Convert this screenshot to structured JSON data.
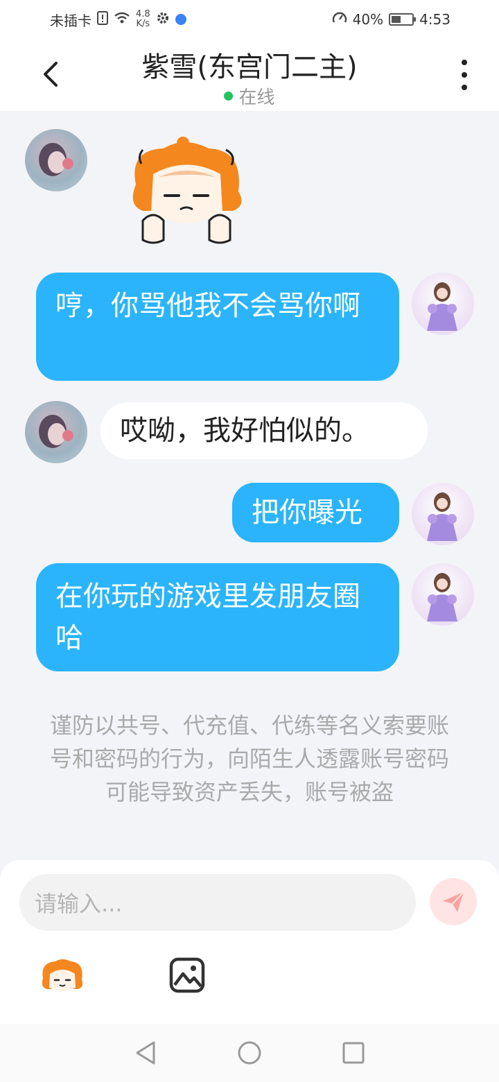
{
  "status_bar": {
    "carrier": "未插卡",
    "net_speed_value": "4.8",
    "net_speed_unit": "K/s",
    "battery": "40%",
    "time": "4:53"
  },
  "header": {
    "title": "紫雪(东宫门二主)",
    "status": "在线"
  },
  "messages": [
    {
      "side": "in",
      "type": "sticker",
      "icon": "orange-hair-character-sticker"
    },
    {
      "side": "out",
      "text": "哼，你骂他我不会骂你啊"
    },
    {
      "side": "in",
      "text": "哎呦，我好怕似的。"
    },
    {
      "side": "out",
      "text": "把你曝光"
    },
    {
      "side": "out",
      "text": "在你玩的游戏里发朋友圈哈"
    }
  ],
  "notice": "谨防以共号、代充值、代练等名义索要账号和密码的行为，向陌生人透露账号密码可能导致资产丢失，账号被盗",
  "input": {
    "placeholder": "请输入..."
  },
  "colors": {
    "outgoing_bubble": "#2bb4fb",
    "incoming_bubble": "#ffffff",
    "online_dot": "#22c55e",
    "send_button_bg": "#ffe4e4",
    "send_icon": "#f9a3a3"
  },
  "icons": [
    "back-icon",
    "more-icon",
    "send-icon",
    "emoji-sticker-icon",
    "image-icon",
    "nav-back-icon",
    "nav-home-icon",
    "nav-recents-icon"
  ]
}
